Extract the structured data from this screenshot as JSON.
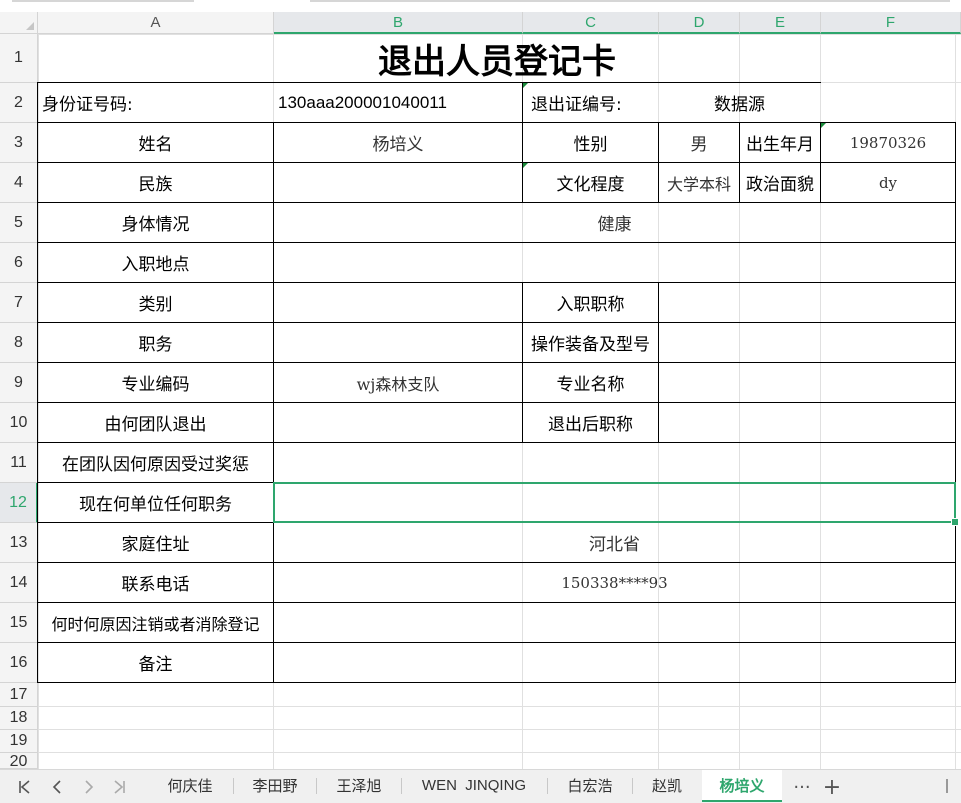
{
  "columns": [
    "A",
    "B",
    "C",
    "D",
    "E",
    "F"
  ],
  "rows": [
    "1",
    "2",
    "3",
    "4",
    "5",
    "6",
    "7",
    "8",
    "9",
    "10",
    "11",
    "12",
    "13",
    "14",
    "15",
    "16",
    "17",
    "18",
    "19",
    "20"
  ],
  "card": {
    "title": "退出人员登记卡",
    "id_label": "身份证号码:",
    "id_value": "130aaa200001040011",
    "exit_no_label": "退出证编号:",
    "data_source": "数据源",
    "name_label": "姓名",
    "name_value": "杨培义",
    "gender_label": "性别",
    "gender_value": "男",
    "birth_label": "出生年月",
    "birth_value": "19870326",
    "ethnicity_label": "民族",
    "education_label": "文化程度",
    "education_value": "大学本科",
    "politics_label": "政治面貌",
    "politics_value": "dy",
    "health_label": "身体情况",
    "health_value": "健康",
    "entry_place_label": "入职地点",
    "category_label": "类别",
    "entry_title_label": "入职职称",
    "duty_label": "职务",
    "equipment_label": "操作装备及型号",
    "major_code_label": "专业编码",
    "major_code_value": "wj森林支队",
    "major_name_label": "专业名称",
    "exit_team_label": "由何团队退出",
    "exit_title_label": "退出后职称",
    "awards_label": "在团队因何原因受过奖惩",
    "current_job_label": "现在何单位任何职务",
    "address_label": "家庭住址",
    "address_value": "河北省",
    "phone_label": "联系电话",
    "phone_value": "150338****93",
    "cancel_label": "何时何原因注销或者消除登记",
    "remarks_label": "备注"
  },
  "tabs": {
    "nav_first": "K",
    "nav_prev": "<",
    "nav_next": ">",
    "nav_last": ">|",
    "sheets": [
      "何庆佳",
      "李田野",
      "王泽旭",
      "WEN  JINQING",
      "白宏浩",
      "赵凯",
      "杨培义"
    ],
    "active_sheet": "杨培义",
    "more": "···",
    "add": "+"
  }
}
